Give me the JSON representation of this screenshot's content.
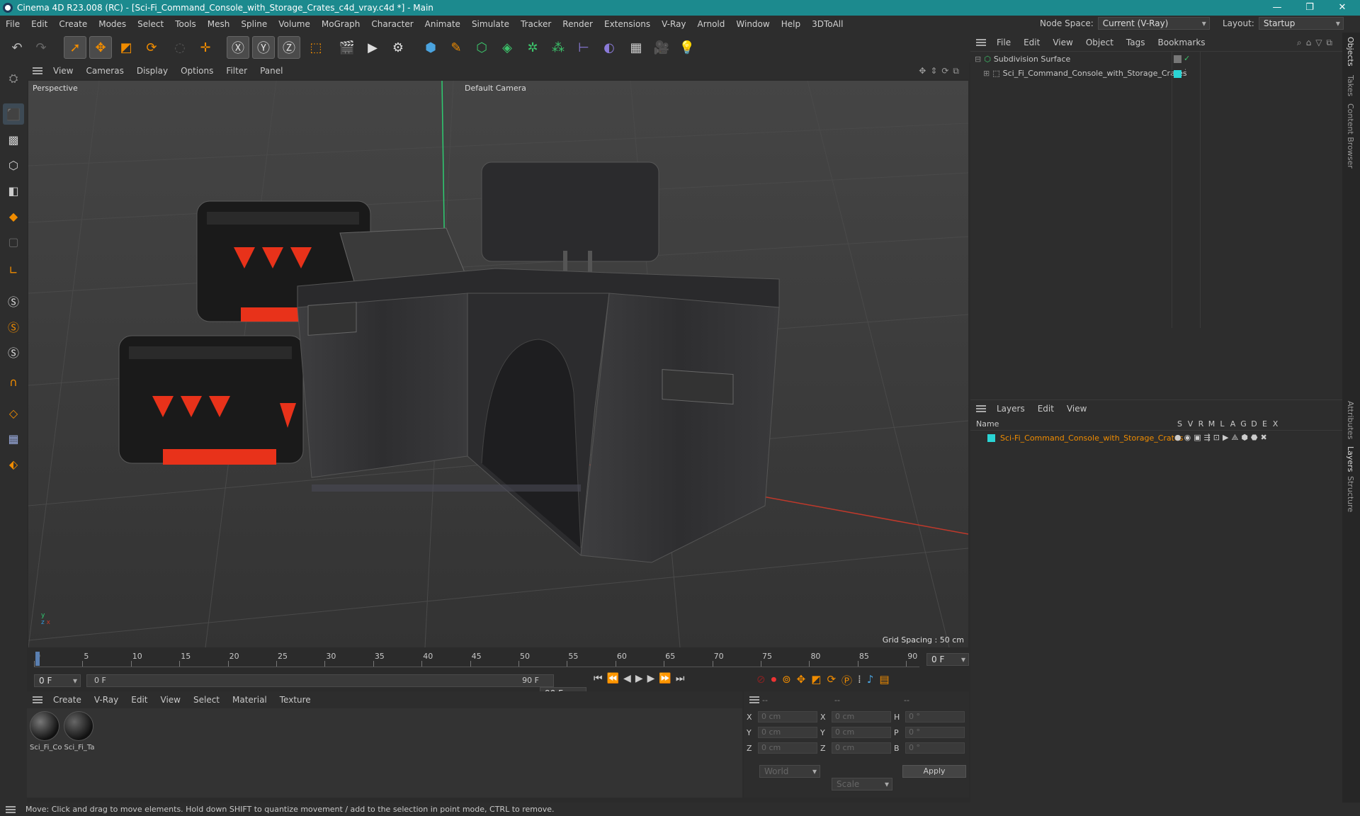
{
  "window": {
    "title": "Cinema 4D R23.008 (RC) - [Sci-Fi_Command_Console_with_Storage_Crates_c4d_vray.c4d *] - Main"
  },
  "menubar": {
    "items": [
      "File",
      "Edit",
      "Create",
      "Modes",
      "Select",
      "Tools",
      "Mesh",
      "Spline",
      "Volume",
      "MoGraph",
      "Character",
      "Animate",
      "Simulate",
      "Tracker",
      "Render",
      "Extensions",
      "V-Ray",
      "Arnold",
      "Window",
      "Help",
      "3DToAll"
    ],
    "node_space_label": "Node Space:",
    "node_space_value": "Current (V-Ray)",
    "layout_label": "Layout:",
    "layout_value": "Startup"
  },
  "viewport": {
    "menu": [
      "View",
      "Cameras",
      "Display",
      "Options",
      "Filter",
      "Panel"
    ],
    "view_name": "Perspective",
    "camera": "Default Camera",
    "grid_spacing": "Grid Spacing : 50 cm"
  },
  "timeline": {
    "ticks": [
      "0",
      "5",
      "10",
      "15",
      "20",
      "25",
      "30",
      "35",
      "40",
      "45",
      "50",
      "55",
      "60",
      "65",
      "70",
      "75",
      "80",
      "85",
      "90"
    ],
    "frame_end": "0 F"
  },
  "transport": {
    "start": "0 F",
    "range_start": "0 F",
    "range_end": "90 F",
    "end": "90 F"
  },
  "materials": {
    "menu": [
      "Create",
      "V-Ray",
      "Edit",
      "View",
      "Select",
      "Material",
      "Texture"
    ],
    "items": [
      {
        "label": "Sci_Fi_Co"
      },
      {
        "label": "Sci_Fi_Ta"
      }
    ]
  },
  "coords": {
    "headers": [
      "--",
      "--",
      "--"
    ],
    "rows": [
      {
        "a": "X",
        "av": "0 cm",
        "b": "X",
        "bv": "0 cm",
        "c": "H",
        "cv": "0 °"
      },
      {
        "a": "Y",
        "av": "0 cm",
        "b": "Y",
        "bv": "0 cm",
        "c": "P",
        "cv": "0 °"
      },
      {
        "a": "Z",
        "av": "0 cm",
        "b": "Z",
        "bv": "0 cm",
        "c": "B",
        "cv": "0 °"
      }
    ],
    "mode1": "World",
    "mode2": "Scale",
    "apply": "Apply"
  },
  "objects": {
    "menu": [
      "File",
      "Edit",
      "View",
      "Object",
      "Tags",
      "Bookmarks"
    ],
    "items": [
      {
        "name": "Subdivision Surface"
      },
      {
        "name": "Sci_Fi_Command_Console_with_Storage_Crates"
      }
    ]
  },
  "layers": {
    "menu": [
      "Layers",
      "Edit",
      "View"
    ],
    "col_name": "Name",
    "cols": [
      "S",
      "V",
      "R",
      "M",
      "L",
      "A",
      "G",
      "D",
      "E",
      "X"
    ],
    "rows": [
      {
        "name": "Sci-Fi_Command_Console_with_Storage_Crates"
      }
    ]
  },
  "sidetabs": [
    "Objects",
    "Takes",
    "Content Browser",
    "Attributes",
    "Layers",
    "Structure"
  ],
  "status": {
    "text": "Move: Click and drag to move elements. Hold down SHIFT to quantize movement / add to the selection in point mode, CTRL to remove."
  },
  "colors": {
    "titlebar": "#1c8a8e",
    "accent": "#f08c00",
    "layer_color": "#2ad4d4",
    "crate_red": "#e8321a"
  }
}
